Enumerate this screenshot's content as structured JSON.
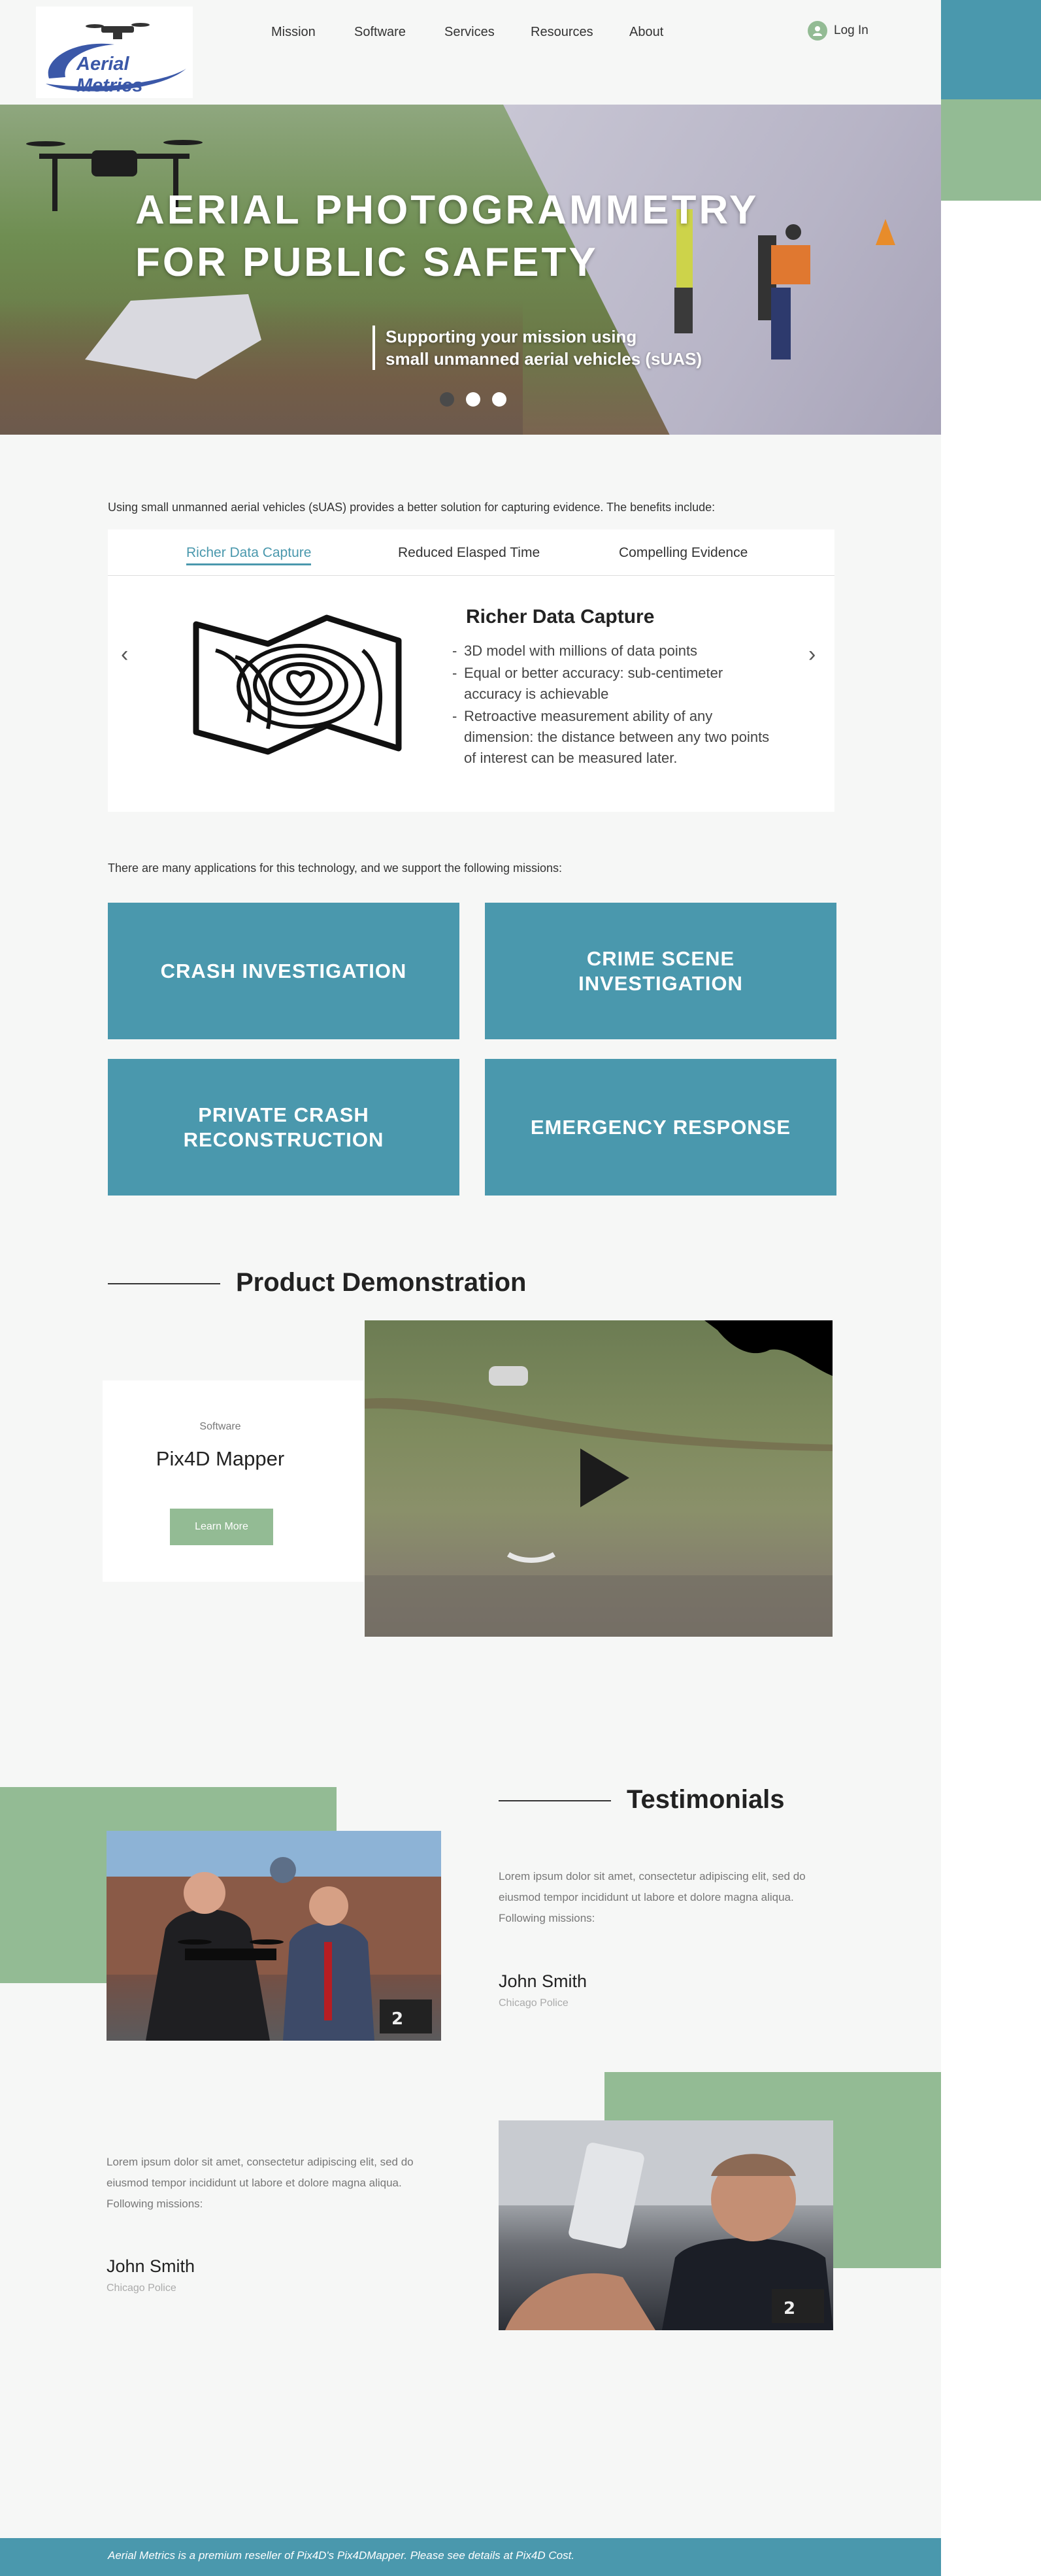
{
  "brand": {
    "name": "Aerial Metrics"
  },
  "nav": {
    "items": [
      "Mission",
      "Software",
      "Services",
      "Resources",
      "About"
    ],
    "login": "Log In"
  },
  "hero": {
    "title_line1": "AERIAL PHOTOGRAMMETRY",
    "title_line2": "FOR PUBLIC SAFETY",
    "sub_line1": "Supporting your mission using",
    "sub_line2": "small unmanned aerial vehicles (sUAS)",
    "slides": 3,
    "active_slide": 1
  },
  "intro": "Using small unmanned aerial vehicles (sUAS) provides a better solution for capturing evidence. The benefits include:",
  "benefits": {
    "tabs": [
      "Richer Data Capture",
      "Reduced Elasped Time",
      "Compelling Evidence"
    ],
    "active_tab": 0,
    "panel_title": "Richer Data Capture",
    "bullets": [
      "3D model with millions of data points",
      "Equal or better accuracy: sub-centimeter accuracy is achievable",
      "Retroactive measurement ability of any dimension: the distance between any two points of interest can be measured later."
    ],
    "icon": "topographic-map-icon"
  },
  "applications_intro": "There are many applications for this technology, and we support the following missions:",
  "missions": [
    "CRASH INVESTIGATION",
    "CRIME SCENE INVESTIGATION",
    "PRIVATE CRASH RECONSTRUCTION",
    "EMERGENCY RESPONSE"
  ],
  "product": {
    "section_title": "Product Demonstration",
    "category": "Software",
    "name": "Pix4D Mapper",
    "button": "Learn More"
  },
  "testimonials": {
    "section_title": "Testimonials",
    "items": [
      {
        "text": "Lorem ipsum dolor sit amet, consectetur adipiscing elit, sed do eiusmod tempor incididunt ut labore et dolore magna aliqua. Following missions:",
        "name": "John Smith",
        "org": "Chicago Police"
      },
      {
        "text": "Lorem ipsum dolor sit amet, consectetur adipiscing elit, sed do eiusmod tempor incididunt ut labore et dolore magna aliqua. Following missions:",
        "name": "John Smith",
        "org": "Chicago Police"
      }
    ]
  },
  "footer": "Aerial Metrics is a premium reseller of Pix4D's Pix4DMapper.  Please see details at Pix4D Cost.",
  "colors": {
    "teal": "#4a98ad",
    "green": "#93bb94",
    "background": "#f6f7f6"
  }
}
